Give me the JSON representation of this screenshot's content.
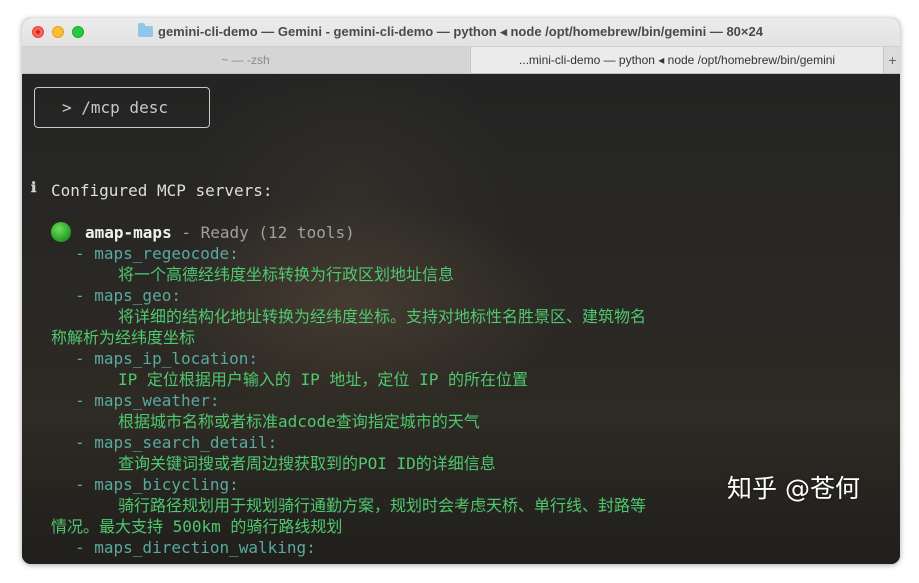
{
  "window": {
    "title": "gemini-cli-demo — Gemini - gemini-cli-demo — python ◂ node /opt/homebrew/bin/gemini — 80×24"
  },
  "tabs": [
    {
      "label": "~ — -zsh",
      "active": false
    },
    {
      "label": "...mini-cli-demo — python ◂ node /opt/homebrew/bin/gemini",
      "active": true
    },
    {
      "label": "+",
      "active": false
    }
  ],
  "input": {
    "value": "> /mcp desc"
  },
  "output": {
    "info_icon": "ℹ",
    "heading": "Configured MCP servers:",
    "server": {
      "status_icon": "green-circle-icon",
      "name": "amap-maps",
      "status": " - Ready (12 tools)"
    },
    "tools": [
      {
        "name": "- maps_regeocode:",
        "desc": [
          "将一个高德经纬度坐标转换为行政区划地址信息"
        ]
      },
      {
        "name": "- maps_geo:",
        "desc": [
          "将详细的结构化地址转换为经纬度坐标。支持对地标性名胜景区、建筑物名",
          "称解析为经纬度坐标"
        ]
      },
      {
        "name": "- maps_ip_location:",
        "desc": [
          "IP 定位根据用户输入的 IP 地址，定位 IP 的所在位置"
        ]
      },
      {
        "name": "- maps_weather:",
        "desc": [
          "根据城市名称或者标准adcode查询指定城市的天气"
        ]
      },
      {
        "name": "- maps_search_detail:",
        "desc": [
          "查询关键词搜或者周边搜获取到的POI ID的详细信息"
        ]
      },
      {
        "name": "- maps_bicycling:",
        "desc": [
          "骑行路径规划用于规划骑行通勤方案，规划时会考虑天桥、单行线、封路等",
          "情况。最大支持 500km 的骑行路线规划"
        ]
      },
      {
        "name": "- maps_direction_walking:",
        "desc": []
      }
    ]
  },
  "watermark": "知乎 @苍何",
  "colors": {
    "close": "#fe5f57",
    "minimize": "#febc2e",
    "maximize": "#28c840",
    "tool_name": "#5aa9a0",
    "description": "#4fc86f"
  }
}
